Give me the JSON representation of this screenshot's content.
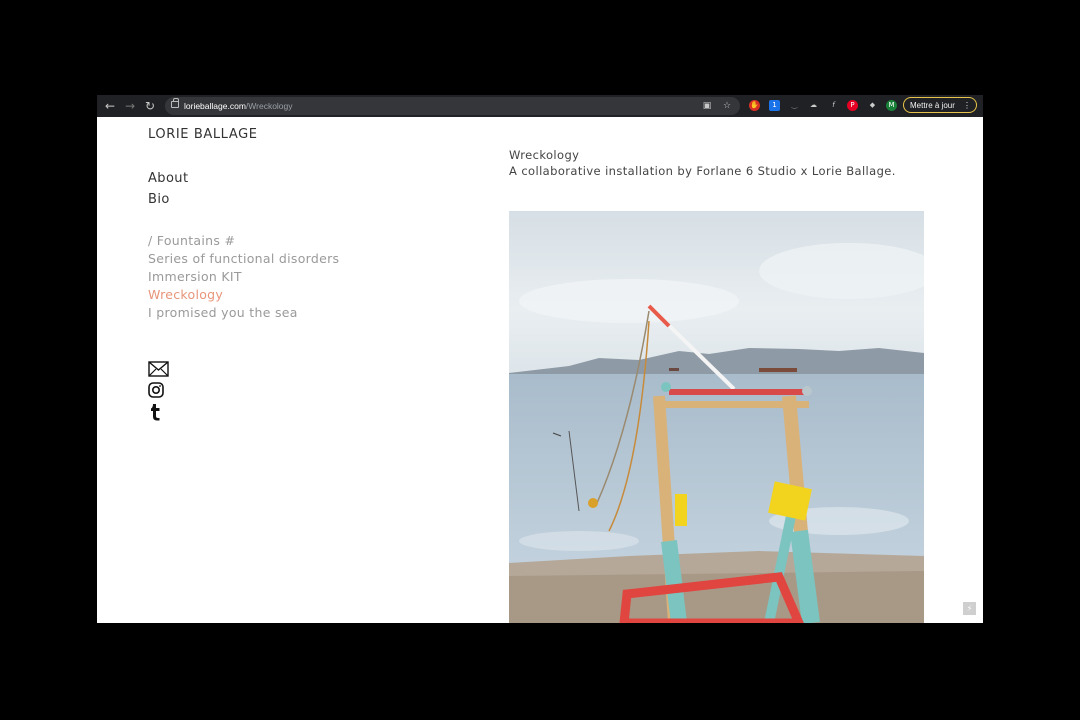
{
  "browser": {
    "url_host": "lorieballage.com",
    "url_path": "/Wreckology",
    "update_button_label": "Mettre à jour",
    "profile_initial": "M",
    "extension_badge": "1"
  },
  "sidebar": {
    "site_title": "LORIE BALLAGE",
    "nav": [
      "About",
      "Bio"
    ],
    "projects": [
      "/ Fountains #",
      "Series of functional disorders",
      "Immersion KIT",
      "Wreckology",
      "I promised you the sea"
    ],
    "active_project": "Wreckology",
    "social_icons": [
      "mail-icon",
      "instagram-icon",
      "tumblr-icon"
    ]
  },
  "main": {
    "title": "Wreckology",
    "subtitle": "A collaborative installation by Forlane 6 Studio x Lorie Ballage."
  },
  "colors": {
    "browser_bar": "#202124",
    "active_link": "#e8957a",
    "update_border": "#e8c34a"
  }
}
